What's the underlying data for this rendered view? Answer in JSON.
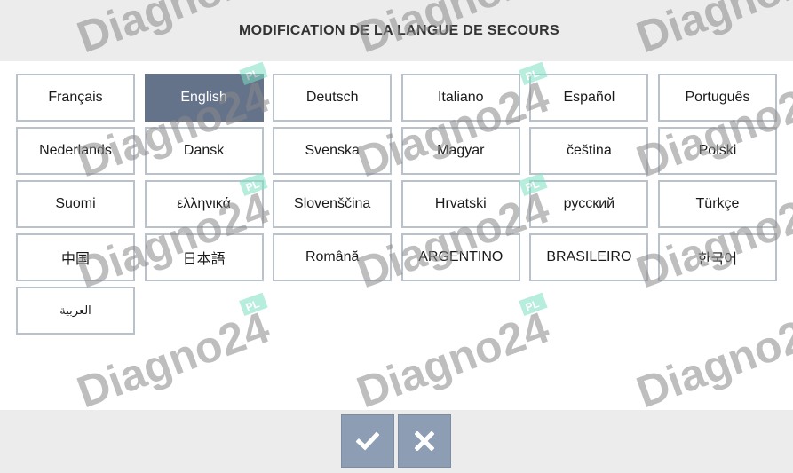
{
  "header": {
    "title": "MODIFICATION DE LA LANGUE DE SECOURS"
  },
  "languages": [
    {
      "label": "Français"
    },
    {
      "label": "English",
      "selected": true
    },
    {
      "label": "Deutsch"
    },
    {
      "label": "Italiano"
    },
    {
      "label": "Español"
    },
    {
      "label": "Português"
    },
    {
      "label": "Nederlands"
    },
    {
      "label": "Dansk"
    },
    {
      "label": "Svenska"
    },
    {
      "label": "Magyar"
    },
    {
      "label": "čeština"
    },
    {
      "label": "Polski"
    },
    {
      "label": "Suomi"
    },
    {
      "label": "ελληνικά"
    },
    {
      "label": "Slovenščina"
    },
    {
      "label": "Hrvatski"
    },
    {
      "label": "русский"
    },
    {
      "label": "Türkçe"
    },
    {
      "label": "中国"
    },
    {
      "label": "日本語"
    },
    {
      "label": "Română"
    },
    {
      "label": "ARGENTINO"
    },
    {
      "label": "BRASILEIRO"
    },
    {
      "label": "한국어"
    },
    {
      "label": "العربية"
    }
  ],
  "footer": {
    "confirm_icon": "check-icon",
    "cancel_icon": "close-icon"
  },
  "watermark": {
    "text": "Diagno24",
    "suffix": "PL"
  },
  "colors": {
    "header_bg": "#ececec",
    "selected_bg": "#64728a",
    "button_border": "#b9c1ca",
    "action_bg": "#8d9db3",
    "watermark_green": "#7ee0c2"
  }
}
